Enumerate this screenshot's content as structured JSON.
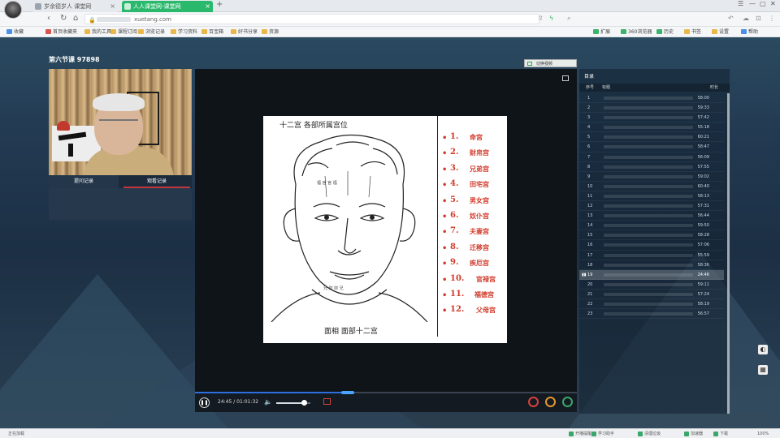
{
  "browser": {
    "tabs": [
      {
        "label": "岁余德岁人 课堂网"
      },
      {
        "label": "人人课堂网-课堂网"
      }
    ],
    "new_tab": "+",
    "url": "xuetang.com",
    "bookmarks": [
      "收藏",
      "首页收藏夹",
      "我的工具",
      "课程订阅",
      "浏览记录",
      "学习资料",
      "百宝箱",
      "好书分享",
      "资源"
    ],
    "bookmarks_right": [
      "扩展",
      "360浏览器",
      "历史",
      "书签",
      "设置",
      "帮助"
    ]
  },
  "course": {
    "title": "第六节课 97898"
  },
  "webcam": {
    "tabs": [
      {
        "label": "提问记录"
      },
      {
        "label": "观看记录"
      }
    ]
  },
  "video": {
    "switch_label": "切换视频",
    "slide": {
      "caption_top": "十二宫 各部所属宫位",
      "caption_bottom": "面相 面部十二宫",
      "palaces": [
        {
          "num": "1.",
          "name": "命宫"
        },
        {
          "num": "2.",
          "name": "财帛宫"
        },
        {
          "num": "3.",
          "name": "兄弟宫"
        },
        {
          "num": "4.",
          "name": "田宅宫"
        },
        {
          "num": "5.",
          "name": "男女宫"
        },
        {
          "num": "6.",
          "name": "奴仆宫"
        },
        {
          "num": "7.",
          "name": "夫妻宫"
        },
        {
          "num": "8.",
          "name": "迁移宫"
        },
        {
          "num": "9.",
          "name": "疾厄宫"
        },
        {
          "num": "10.",
          "name": "官禄宫"
        },
        {
          "num": "11.",
          "name": "福德宫"
        },
        {
          "num": "12.",
          "name": "父母宫"
        }
      ]
    },
    "controls": {
      "time": "24:45 / 01:01:32",
      "progress": 0.4,
      "volume": 0.8
    }
  },
  "catalog": {
    "title": "目录",
    "headers": {
      "num": "序号",
      "title": "标题",
      "duration": "时长"
    },
    "rows": [
      {
        "num": "1",
        "duration": "58:00"
      },
      {
        "num": "2",
        "duration": "59:33"
      },
      {
        "num": "3",
        "duration": "57:42"
      },
      {
        "num": "4",
        "duration": "55:18"
      },
      {
        "num": "5",
        "duration": "60:21"
      },
      {
        "num": "6",
        "duration": "58:47"
      },
      {
        "num": "7",
        "duration": "56:09"
      },
      {
        "num": "8",
        "duration": "57:55"
      },
      {
        "num": "9",
        "duration": "59:02"
      },
      {
        "num": "10",
        "duration": "60:40"
      },
      {
        "num": "11",
        "duration": "58:13"
      },
      {
        "num": "12",
        "duration": "57:31"
      },
      {
        "num": "13",
        "duration": "56:44"
      },
      {
        "num": "14",
        "duration": "59:50"
      },
      {
        "num": "15",
        "duration": "58:28"
      },
      {
        "num": "16",
        "duration": "57:06"
      },
      {
        "num": "17",
        "duration": "55:59"
      },
      {
        "num": "18",
        "duration": "58:36"
      },
      {
        "num": "19",
        "duration": "24:46",
        "active": true
      },
      {
        "num": "20",
        "duration": "59:11"
      },
      {
        "num": "21",
        "duration": "57:24"
      },
      {
        "num": "22",
        "duration": "58:19"
      },
      {
        "num": "23",
        "duration": "56:57"
      }
    ]
  },
  "statusbar": {
    "left": "正在加载",
    "items": [
      "开播提醒",
      "学习助手",
      "清理垃圾",
      "加速器",
      "下载",
      "100%"
    ]
  },
  "colors": {
    "accent": "#2ab96c",
    "palace_red": "#d13a2a",
    "progress_blue": "#2d6fe0"
  }
}
